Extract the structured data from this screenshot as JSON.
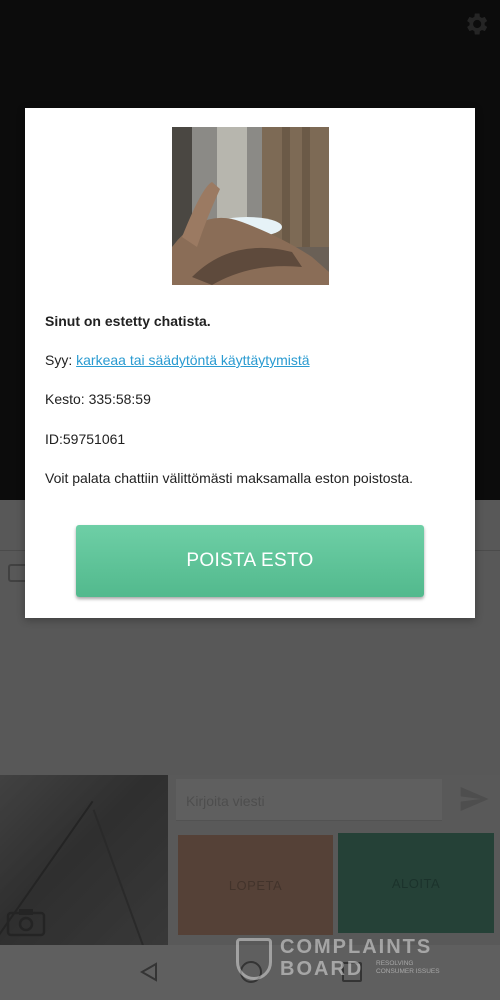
{
  "dialog": {
    "title": "Sinut on estetty chatista.",
    "reason_prefix": "Syy: ",
    "reason_link": "karkeaa tai säädytöntä käyttäytymistä",
    "duration": "Kesto: 335:58:59",
    "id": "ID:59751061",
    "info": "Voit palata chattiin välittömästi maksamalla eston poistosta.",
    "unblock_button": "POISTA ESTO",
    "button_color": "#5cc498",
    "link_color": "#2a9bd1"
  },
  "chat": {
    "input_placeholder": "Kirjoita viesti",
    "stop_button": "LOPETA",
    "start_button": "ALOITA"
  },
  "watermark": {
    "line1": "COMPLAINTS",
    "line2": "BOARD",
    "tagline": "RESOLVING CONSUMER ISSUES"
  },
  "icons": [
    "gear-icon",
    "report-icon",
    "camera-switch-icon",
    "send-icon",
    "back-icon",
    "home-icon",
    "recent-apps-icon"
  ]
}
